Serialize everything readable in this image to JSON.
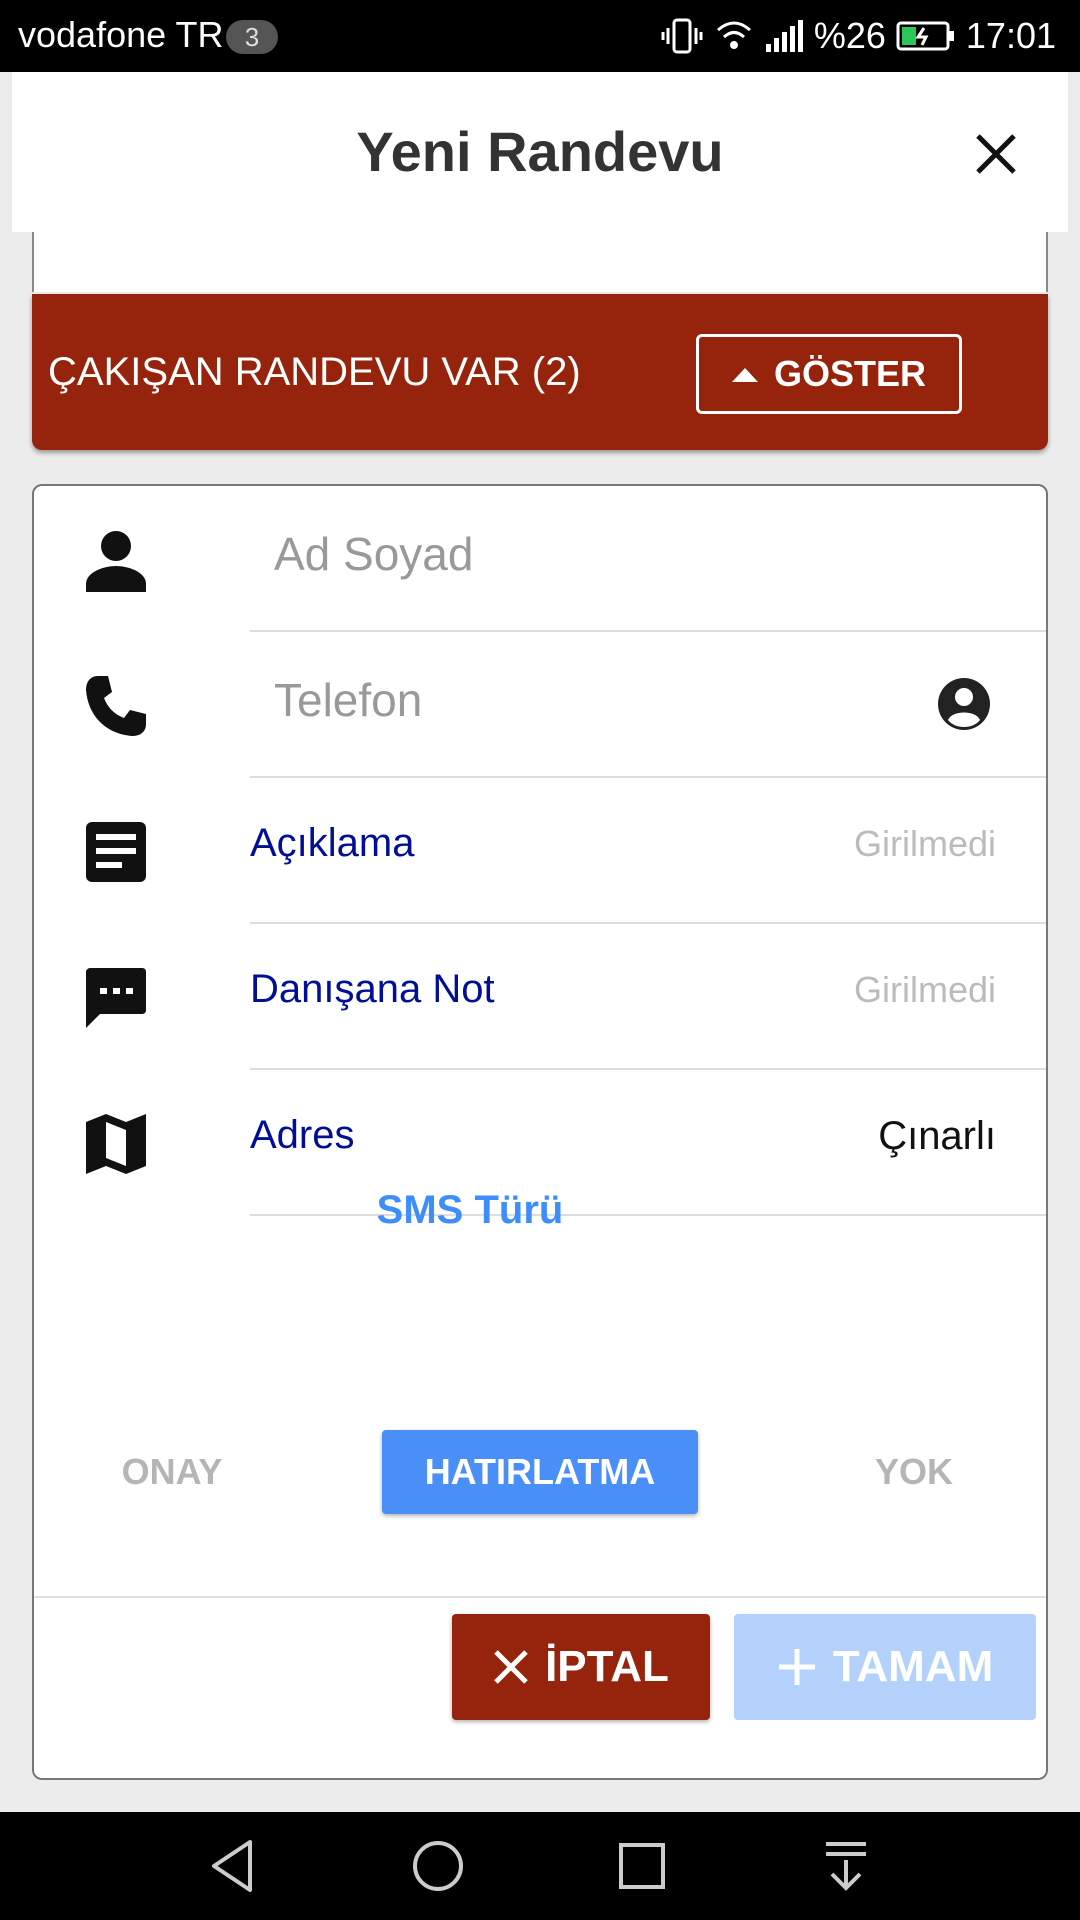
{
  "status_bar": {
    "carrier": "vodafone TR",
    "notification_count": "3",
    "battery": "%26",
    "time": "17:01"
  },
  "header": {
    "title": "Yeni Randevu"
  },
  "conflict": {
    "text": "ÇAKIŞAN RANDEVU VAR (2)",
    "show_label": "GÖSTER"
  },
  "form": {
    "name_placeholder": "Ad Soyad",
    "phone_placeholder": "Telefon",
    "rows": [
      {
        "label": "Açıklama",
        "value": "Girilmedi"
      },
      {
        "label": "Danışana Not",
        "value": "Girilmedi"
      },
      {
        "label": "Adres",
        "value": "Çınarlı"
      }
    ],
    "sms_title": "SMS Türü",
    "sms_options": [
      "ONAY",
      "HATIRLATMA",
      "YOK"
    ],
    "sms_selected": "HATIRLATMA"
  },
  "actions": {
    "cancel_label": "İPTAL",
    "ok_label": "TAMAM"
  },
  "colors": {
    "conflict_red": "#96230c",
    "accent_blue": "#4a8ef8",
    "label_blue": "#000f96"
  }
}
